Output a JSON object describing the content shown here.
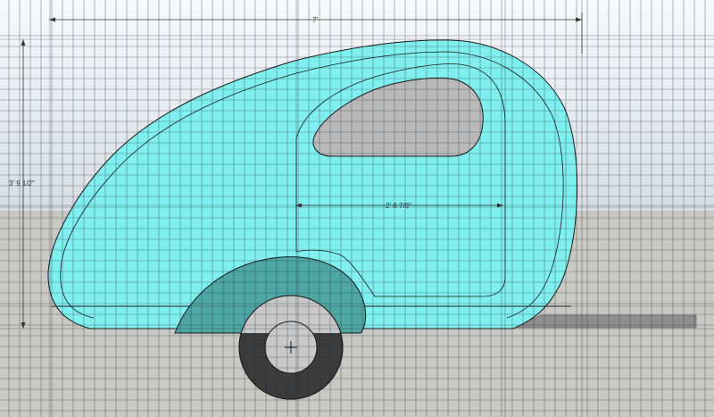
{
  "drawing": {
    "dimensions": {
      "overall_length": "7'",
      "overall_height": "3' 9 1/2\"",
      "door_width": "2' 8 7/8\""
    }
  },
  "colors": {
    "sky_top": "#f8f9fb",
    "sky_bottom": "#d7dde3",
    "ground": "#c9c8c3",
    "body_fill": "#7ff0ef",
    "body_outline": "#1a1a1a",
    "window_fill": "#b9b9b9",
    "fender_fill": "#4ea7a5",
    "tire": "#3c3c3c",
    "rim": "#c8c8c8",
    "tongue": "#8f8f8f",
    "grid_line": "#1f2933"
  },
  "objects": {
    "body": "teardrop-trailer-body",
    "window": "window-cutout",
    "door": "door-outline",
    "fender": "wheel-fender",
    "wheel": "wheel",
    "tongue": "trailer-tongue"
  }
}
